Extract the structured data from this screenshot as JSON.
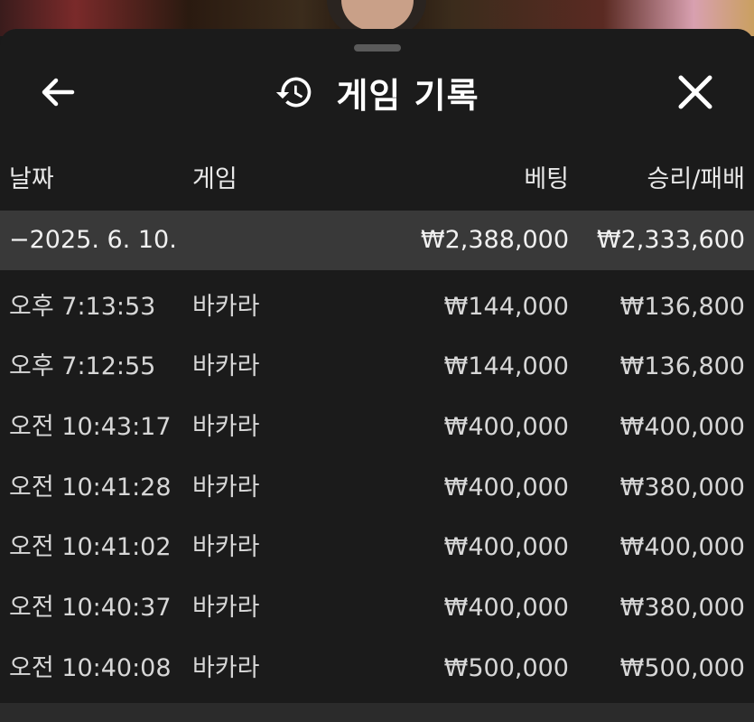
{
  "header": {
    "title": "게임 기록"
  },
  "columns": {
    "date": "날짜",
    "game": "게임",
    "bet": "베팅",
    "win_loss": "승리/패배"
  },
  "group": {
    "date": "−2025. 6. 10.",
    "bet_total": "₩2,388,000",
    "win_total": "₩2,333,600"
  },
  "rows": [
    {
      "time": "오후 7:13:53",
      "game": "바카라",
      "bet": "₩144,000",
      "win": "₩136,800"
    },
    {
      "time": "오후 7:12:55",
      "game": "바카라",
      "bet": "₩144,000",
      "win": "₩136,800"
    },
    {
      "time": "오전 10:43:17",
      "game": "바카라",
      "bet": "₩400,000",
      "win": "₩400,000"
    },
    {
      "time": "오전 10:41:28",
      "game": "바카라",
      "bet": "₩400,000",
      "win": "₩380,000"
    },
    {
      "time": "오전 10:41:02",
      "game": "바카라",
      "bet": "₩400,000",
      "win": "₩400,000"
    },
    {
      "time": "오전 10:40:37",
      "game": "바카라",
      "bet": "₩400,000",
      "win": "₩380,000"
    },
    {
      "time": "오전 10:40:08",
      "game": "바카라",
      "bet": "₩500,000",
      "win": "₩500,000"
    }
  ]
}
